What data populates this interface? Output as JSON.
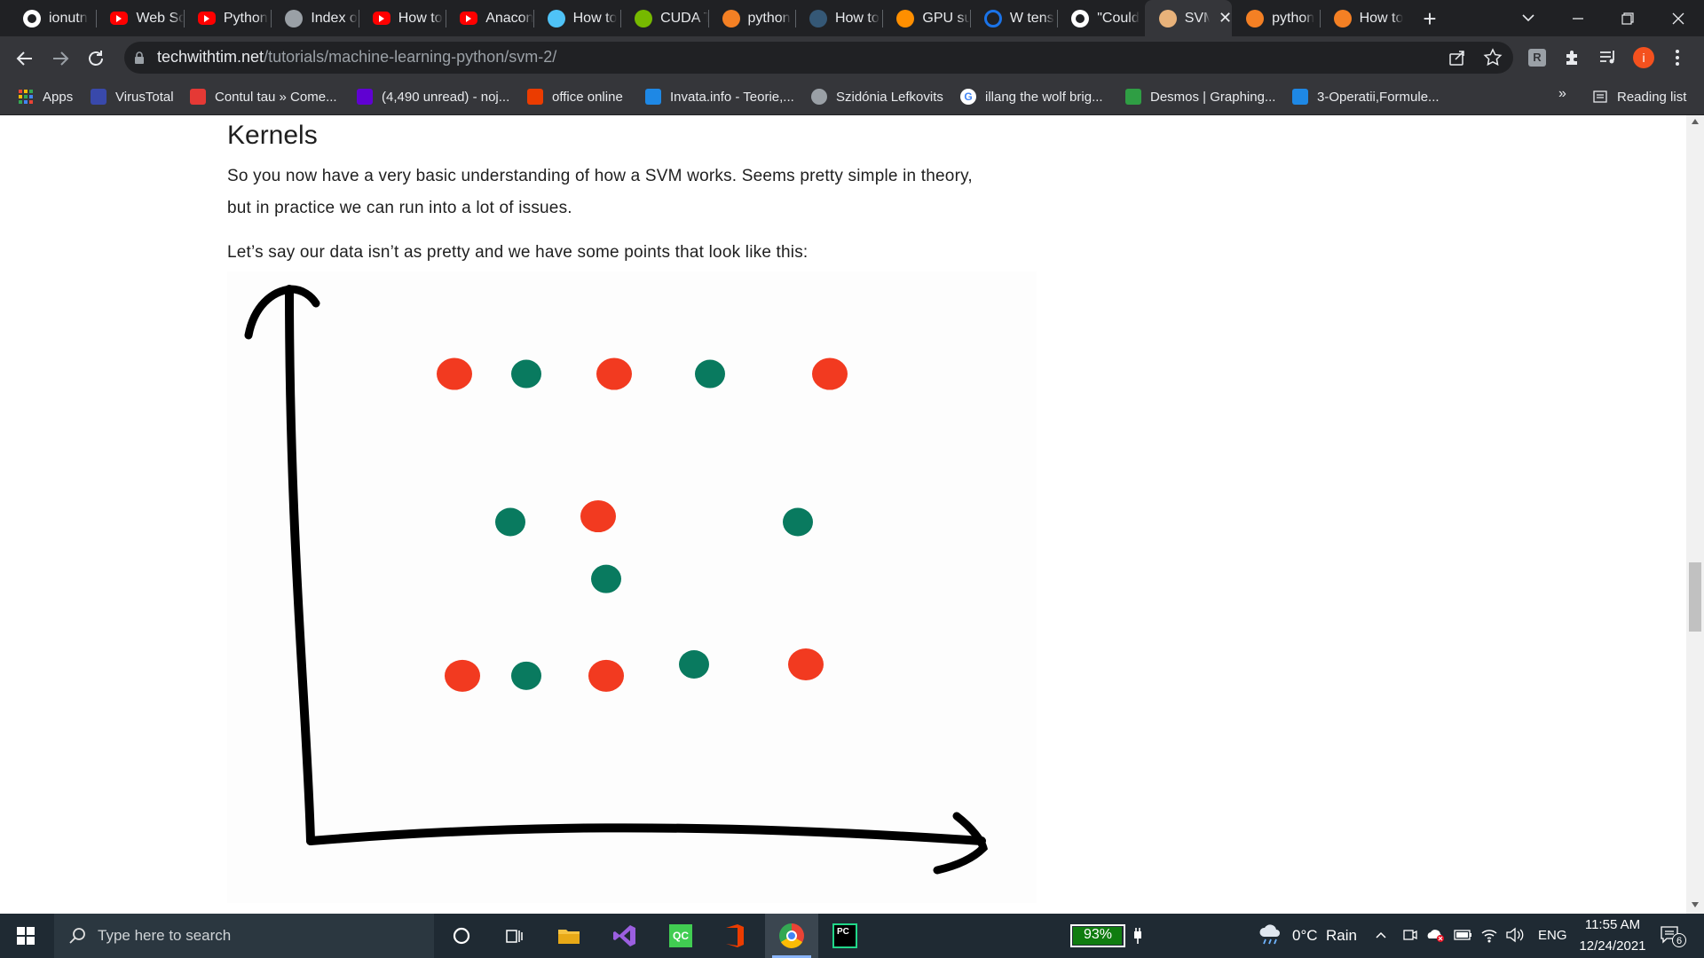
{
  "browser": {
    "tabs": [
      {
        "label": "ionutn",
        "icon": "github-icon",
        "color": "#ffffff"
      },
      {
        "label": "Web Sc",
        "icon": "youtube-icon",
        "color": "#ff0000"
      },
      {
        "label": "Python",
        "icon": "youtube-icon",
        "color": "#ff0000"
      },
      {
        "label": "Index o",
        "icon": "globe-icon",
        "color": "#9aa0a6"
      },
      {
        "label": "How to",
        "icon": "youtube-icon",
        "color": "#ff0000"
      },
      {
        "label": "Anacon",
        "icon": "youtube-icon",
        "color": "#ff0000"
      },
      {
        "label": "How to",
        "icon": "eye-icon",
        "color": "#4fc3f7"
      },
      {
        "label": "CUDA T",
        "icon": "nvidia-icon",
        "color": "#76b900"
      },
      {
        "label": "python",
        "icon": "stackoverflow-icon",
        "color": "#f48024"
      },
      {
        "label": "How to",
        "icon": "tds-icon",
        "color": "#355876"
      },
      {
        "label": "GPU su",
        "icon": "tensorflow-icon",
        "color": "#ff8f00"
      },
      {
        "label": "W tens",
        "icon": "circle-icon",
        "color": "#1a73e8"
      },
      {
        "label": "\"Could",
        "icon": "github-icon",
        "color": "#ffffff"
      },
      {
        "label": "SVM",
        "icon": "twt-icon",
        "color": "#e8b27a",
        "active": true
      },
      {
        "label": "python",
        "icon": "stackoverflow-icon",
        "color": "#f48024"
      },
      {
        "label": "How to",
        "icon": "stackoverflow-icon",
        "color": "#f48024"
      }
    ],
    "url_domain": "techwithtim.net",
    "url_path": "/tutorials/machine-learning-python/svm-2/",
    "bookmarks": [
      {
        "label": "Apps",
        "icon": "apps-grid-icon",
        "color": "#4285f4"
      },
      {
        "label": "VirusTotal",
        "icon": "virustotal-icon",
        "color": "#3949ab"
      },
      {
        "label": "Contul tau » Come...",
        "icon": "emag-icon",
        "color": "#e53935"
      },
      {
        "label": "(4,490 unread) - noj...",
        "icon": "yahoo-mail-icon",
        "color": "#6001d2"
      },
      {
        "label": "office online",
        "icon": "office-icon",
        "color": "#eb3c00"
      },
      {
        "label": "Invata.info - Teorie,...",
        "icon": "invata-icon",
        "color": "#1e88e5"
      },
      {
        "label": "Szidónia Lefkovits",
        "icon": "globe-icon",
        "color": "#9aa0a6"
      },
      {
        "label": "illang the wolf brig...",
        "icon": "google-icon",
        "color": "#ffffff"
      },
      {
        "label": "Desmos | Graphing...",
        "icon": "desmos-icon",
        "color": "#2f9e44"
      },
      {
        "label": "3-Operatii,Formule...",
        "icon": "site-icon",
        "color": "#1e88e5"
      }
    ],
    "reading_list": "Reading list",
    "overflow": "»",
    "profile_initial": "i"
  },
  "article": {
    "heading": "Kernels",
    "para1_line1": "So you now have a very basic understanding of how a SVM works. Seems pretty simple in theory,",
    "para1_line2": "but in practice we can run into a lot of issues.",
    "para2": "Let’s say our data isn’t as pretty and we have some points that look like this:"
  },
  "figure": {
    "points": [
      {
        "cls": "red",
        "x": 0.18,
        "y": 0.82
      },
      {
        "cls": "green",
        "x": 0.27,
        "y": 0.82
      },
      {
        "cls": "red",
        "x": 0.38,
        "y": 0.82
      },
      {
        "cls": "green",
        "x": 0.5,
        "y": 0.82
      },
      {
        "cls": "red",
        "x": 0.65,
        "y": 0.82
      },
      {
        "cls": "green",
        "x": 0.25,
        "y": 0.56
      },
      {
        "cls": "red",
        "x": 0.36,
        "y": 0.57
      },
      {
        "cls": "green",
        "x": 0.37,
        "y": 0.46
      },
      {
        "cls": "green",
        "x": 0.61,
        "y": 0.56
      },
      {
        "cls": "red",
        "x": 0.19,
        "y": 0.29
      },
      {
        "cls": "green",
        "x": 0.27,
        "y": 0.29
      },
      {
        "cls": "red",
        "x": 0.37,
        "y": 0.29
      },
      {
        "cls": "green",
        "x": 0.48,
        "y": 0.31
      },
      {
        "cls": "red",
        "x": 0.62,
        "y": 0.31
      }
    ],
    "colors": {
      "red": "#f23a20",
      "green": "#097a5f",
      "axis": "#000000"
    }
  },
  "taskbar": {
    "search_placeholder": "Type here to search",
    "battery": "93%",
    "weather": "0°C  Rain",
    "language": "ENG",
    "time": "11:55 AM",
    "date": "12/24/2021",
    "notifications": "6"
  }
}
